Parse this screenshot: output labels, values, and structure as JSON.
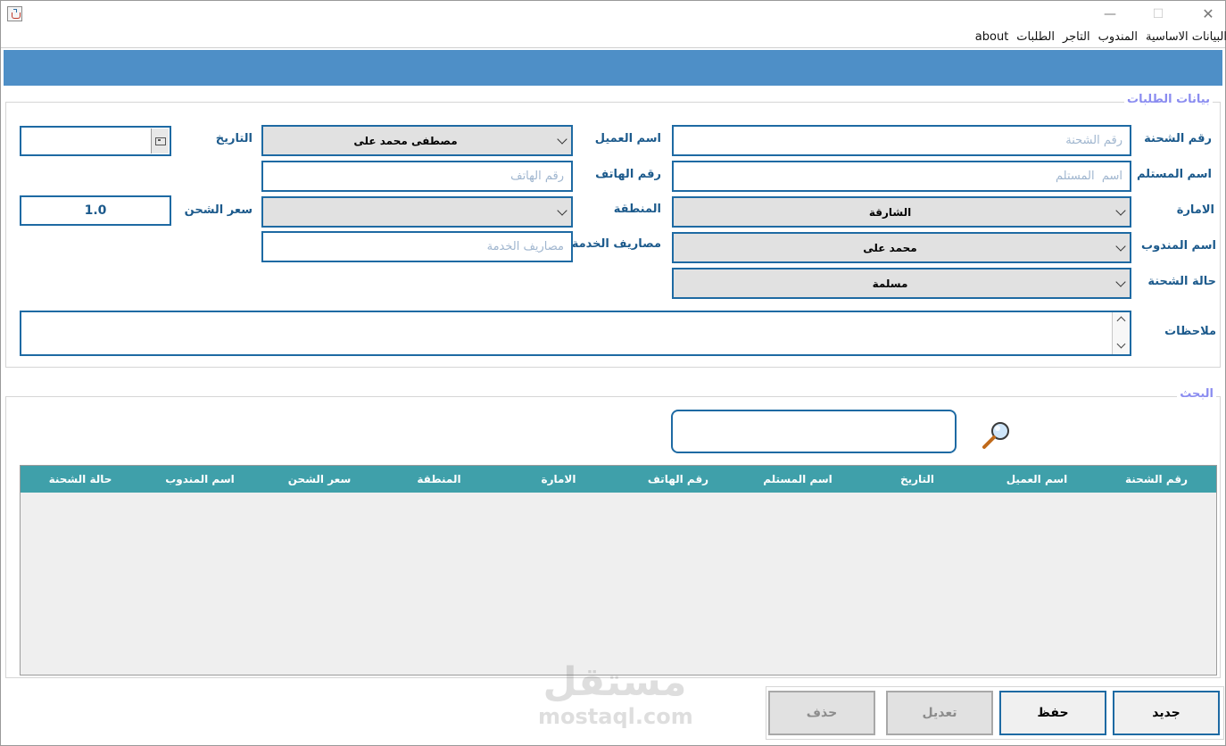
{
  "window": {
    "minimize_glyph": "—",
    "maximize_glyph": "☐",
    "close_glyph": "✕"
  },
  "menu": [
    "about",
    "الطلبات",
    "التاجر",
    "المندوب",
    "البيانات الاساسية"
  ],
  "order_section": {
    "title": "بيانات الطلبات",
    "labels": {
      "shipment_no": "رقم الشحنة",
      "customer_name": "اسم العميل",
      "date": "التاريخ",
      "receiver_name": "اسم  المستلم",
      "phone": "رقم الهاتف",
      "emirate": "الامارة",
      "region": "المنطقة",
      "shipping_price": "سعر الشحن",
      "delegate_name": "اسم المندوب",
      "service_fees": "مصاريف الخدمة",
      "shipment_status": "حالة الشحنة",
      "notes": "ملاحظات"
    },
    "placeholders": {
      "shipment_no": "رقم الشحنة",
      "receiver_name": "اسم  المستلم",
      "phone": "رقم الهاتف",
      "service_fees": "مصاريف الخدمة"
    },
    "values": {
      "customer": "مصطفى محمد على",
      "emirate": "الشارقة",
      "region": "",
      "delegate": "محمد على",
      "status": "مسلمة",
      "shipping_price": "1.0",
      "date": ""
    }
  },
  "search_section": {
    "title": "البحث",
    "query": ""
  },
  "table": {
    "columns": [
      "رقم الشحنة",
      "اسم العميل",
      "التاريخ",
      "اسم المستلم",
      "رقم الهاتف",
      "الامارة",
      "المنطقة",
      "سعر الشحن",
      "اسم المندوب",
      "حالة الشحنة"
    ],
    "rows": []
  },
  "buttons": {
    "new": "جديد",
    "save": "حفظ",
    "edit": "تعديل",
    "delete": "حذف"
  },
  "watermark": {
    "arabic": "مستقل",
    "latin": "mostaql.com"
  },
  "colors": {
    "header_band": "#4e8fc7",
    "field_border": "#1e6aa3",
    "label_text": "#1c5a8c",
    "table_header": "#3fa0aa",
    "group_title": "#8a8cf0"
  }
}
